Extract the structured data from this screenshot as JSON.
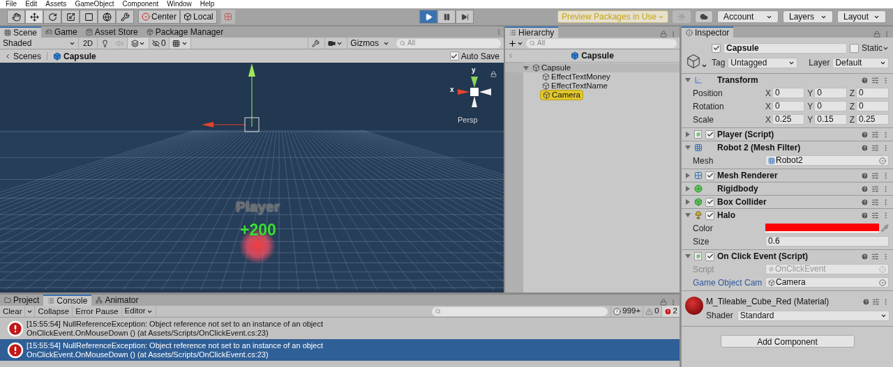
{
  "menu": [
    "File",
    "Edit",
    "Assets",
    "GameObject",
    "Component",
    "Window",
    "Help"
  ],
  "toolbar": {
    "tools": [
      {
        "kind": "hand",
        "selected": false
      },
      {
        "kind": "move",
        "selected": true
      },
      {
        "kind": "rotate",
        "selected": false
      },
      {
        "kind": "scale",
        "selected": false
      },
      {
        "kind": "rect",
        "selected": false
      },
      {
        "kind": "transform",
        "selected": false
      },
      {
        "kind": "custom",
        "selected": false
      }
    ],
    "pivot": "Center",
    "space": "Local",
    "play": [
      {
        "kind": "play",
        "selected": true
      },
      {
        "kind": "pause",
        "selected": false
      },
      {
        "kind": "step",
        "selected": false
      }
    ],
    "preview_packages": "Preview Packages in Use",
    "account": "Account",
    "layers": "Layers",
    "layout": "Layout"
  },
  "scene_panel": {
    "tabs": [
      {
        "label": "Scene",
        "kind": "scene",
        "selected": true
      },
      {
        "label": "Game",
        "kind": "game",
        "selected": false
      },
      {
        "label": "Asset Store",
        "kind": "store",
        "selected": false
      },
      {
        "label": "Package Manager",
        "kind": "package",
        "selected": false
      }
    ],
    "shading": "Shaded",
    "mode_2d": "2D",
    "hidden_count": "0",
    "gizmos": "Gizmos",
    "search_placeholder": "All",
    "breadcrumb": [
      "Scenes",
      "Capsule"
    ],
    "auto_save": {
      "label": "Auto Save",
      "checked": true
    },
    "viewport": {
      "axis_x": "x",
      "axis_y": "y",
      "projection": "Persp",
      "name_text": "Player",
      "money_text": "+200"
    }
  },
  "hierarchy": {
    "title": "Hierarchy",
    "search_placeholder": "All",
    "scene": "Capsule",
    "tree": [
      {
        "label": "Capsule",
        "expanded": true,
        "selected": false,
        "children": [
          {
            "label": "EffectTextMoney",
            "selected": false
          },
          {
            "label": "EffectTextName",
            "selected": false
          },
          {
            "label": "Camera",
            "selected": true
          }
        ]
      }
    ]
  },
  "inspector": {
    "title": "Inspector",
    "object": {
      "name": "Capsule",
      "active": true,
      "static_label": "Static",
      "static": false,
      "tag_label": "Tag",
      "tag": "Untagged",
      "layer_label": "Layer",
      "layer": "Default"
    },
    "components": [
      {
        "title": "Transform",
        "kind": "transform",
        "expanded": true,
        "properties": [
          {
            "label": "Position",
            "kind": "vector3",
            "disabled": false,
            "focused": false,
            "values": [
              {
                "axis": "X",
                "value": "0"
              },
              {
                "axis": "Y",
                "value": "0"
              },
              {
                "axis": "Z",
                "value": "0"
              }
            ]
          },
          {
            "label": "Rotation",
            "kind": "vector3",
            "disabled": false,
            "focused": false,
            "values": [
              {
                "axis": "X",
                "value": "0"
              },
              {
                "axis": "Y",
                "value": "0"
              },
              {
                "axis": "Z",
                "value": "0"
              }
            ]
          },
          {
            "label": "Scale",
            "kind": "vector3",
            "disabled": false,
            "focused": false,
            "values": [
              {
                "axis": "X",
                "value": "0.25"
              },
              {
                "axis": "Y",
                "value": "0.15"
              },
              {
                "axis": "Z",
                "value": "0.25"
              }
            ]
          }
        ]
      },
      {
        "title": "Player (Script)",
        "kind": "script",
        "expanded": false,
        "enabled": true
      },
      {
        "title": "Robot 2 (Mesh Filter)",
        "kind": "mesh-filter",
        "expanded": true,
        "properties": [
          {
            "label": "Mesh",
            "kind": "mesh",
            "disabled": false,
            "focused": false,
            "value": "Robot2"
          }
        ]
      },
      {
        "title": "Mesh Renderer",
        "kind": "mesh-renderer",
        "expanded": false,
        "enabled": true
      },
      {
        "title": "Rigidbody",
        "kind": "rigidbody",
        "expanded": false
      },
      {
        "title": "Box Collider",
        "kind": "box-collider",
        "expanded": false,
        "enabled": true
      },
      {
        "title": "Halo",
        "kind": "halo",
        "expanded": true,
        "enabled": true,
        "properties": [
          {
            "label": "Color",
            "kind": "color",
            "disabled": false,
            "focused": false,
            "color": "#ff0000"
          },
          {
            "label": "Size",
            "kind": "text",
            "disabled": false,
            "focused": false,
            "value": "0.6"
          }
        ]
      },
      {
        "title": "On Click Event (Script)",
        "kind": "script",
        "expanded": true,
        "enabled": true,
        "properties": [
          {
            "label": "Script",
            "kind": "script",
            "disabled": true,
            "focused": false,
            "value": "OnClickEvent"
          },
          {
            "label": "Game Object Cam",
            "kind": "gameobject",
            "disabled": false,
            "focused": true,
            "value": "Camera"
          }
        ]
      }
    ],
    "material": {
      "name": "M_Tileable_Cube_Red (Material)",
      "shader_label": "Shader",
      "shader": "Standard"
    },
    "add_component": "Add Component"
  },
  "console": {
    "tabs": [
      {
        "label": "Project",
        "kind": "project",
        "selected": false
      },
      {
        "label": "Console",
        "kind": "console",
        "selected": true
      },
      {
        "label": "Animator",
        "kind": "animator",
        "selected": false
      }
    ],
    "buttons": {
      "clear": "Clear",
      "collapse": "Collapse",
      "error_pause": "Error Pause",
      "editor": "Editor"
    },
    "counts": {
      "logs": "999+",
      "warnings": "0",
      "errors": "2"
    },
    "entries": [
      {
        "line1": "[15:55:54] NullReferenceException: Object reference not set to an instance of an object",
        "line2": "OnClickEvent.OnMouseDown () (at Assets/Scripts/OnClickEvent.cs:23)",
        "selected": false
      },
      {
        "line1": "[15:55:54] NullReferenceException: Object reference not set to an instance of an object",
        "line2": "OnClickEvent.OnMouseDown () (at Assets/Scripts/OnClickEvent.cs:23)",
        "selected": true
      }
    ]
  }
}
